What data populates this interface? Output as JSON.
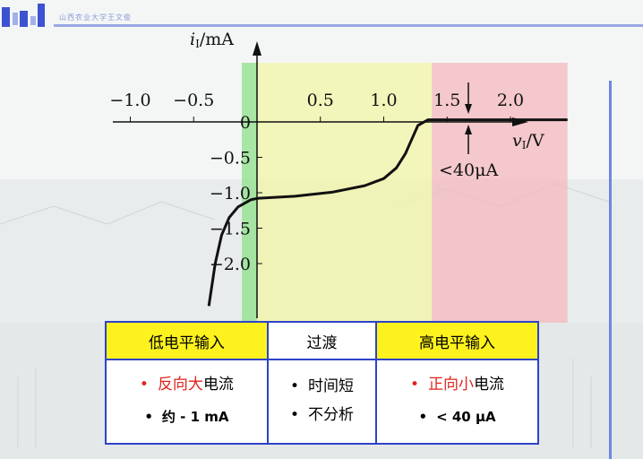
{
  "header": {
    "title": "山西农业大学王文俊"
  },
  "chart_data": {
    "type": "line",
    "title": "",
    "xlabel": "v_I / V",
    "ylabel": "i_I / mA",
    "xlim": [
      -1.7,
      2.6
    ],
    "ylim": [
      -2.7,
      0.6
    ],
    "x_ticks": [
      "−1.0",
      "−0.5",
      "0.5",
      "1.0",
      "1.5",
      "2.0"
    ],
    "x_tick_values": [
      -1.0,
      -0.5,
      0.5,
      1.0,
      1.5,
      2.0
    ],
    "y_ticks": [
      "0",
      "−0.5",
      "−1.0",
      "−1.5",
      "−2.0"
    ],
    "y_tick_values": [
      0,
      -0.5,
      -1.0,
      -1.5,
      -2.0
    ],
    "x_axis_label_italic": "v",
    "x_axis_label_sub": "I",
    "x_axis_label_rest": "/V",
    "y_axis_label_italic": "i",
    "y_axis_label_sub": "I",
    "y_axis_label_rest": "/mA",
    "annotation": "<40μA",
    "series": [
      {
        "x": [
          -0.38,
          -0.33,
          -0.28,
          -0.22,
          -0.15,
          -0.05,
          0.0,
          0.3,
          0.6,
          0.85,
          1.0,
          1.1,
          1.17,
          1.22,
          1.27,
          1.35,
          1.5,
          2.0,
          2.45
        ],
        "y": [
          -2.6,
          -2.0,
          -1.6,
          -1.35,
          -1.2,
          -1.1,
          -1.08,
          -1.05,
          -0.99,
          -0.9,
          -0.8,
          -0.65,
          -0.45,
          -0.25,
          -0.05,
          0.03,
          0.03,
          0.03,
          0.03
        ]
      }
    ],
    "regions": [
      {
        "x": [
          -0.12,
          0.0
        ],
        "color": "#8fe08a"
      },
      {
        "x": [
          0.0,
          1.38
        ],
        "color": "#f2f5a6"
      },
      {
        "x": [
          1.38,
          2.45
        ],
        "color": "#f4b8be"
      }
    ]
  },
  "table": {
    "headers": [
      "低电平输入",
      "过渡",
      "高电平输入"
    ],
    "col1": {
      "red": "反向大",
      "black": "电流",
      "line2": "约 - 1 mA"
    },
    "col2": {
      "line1": "时间短",
      "line2": "不分析"
    },
    "col3": {
      "red": "正向小",
      "black": "电流",
      "line2": "< 40 μA"
    },
    "bullet": "•"
  },
  "colors": {
    "accent": "#2d43c8",
    "yellow": "#fdf21d",
    "red": "#e0241d"
  }
}
